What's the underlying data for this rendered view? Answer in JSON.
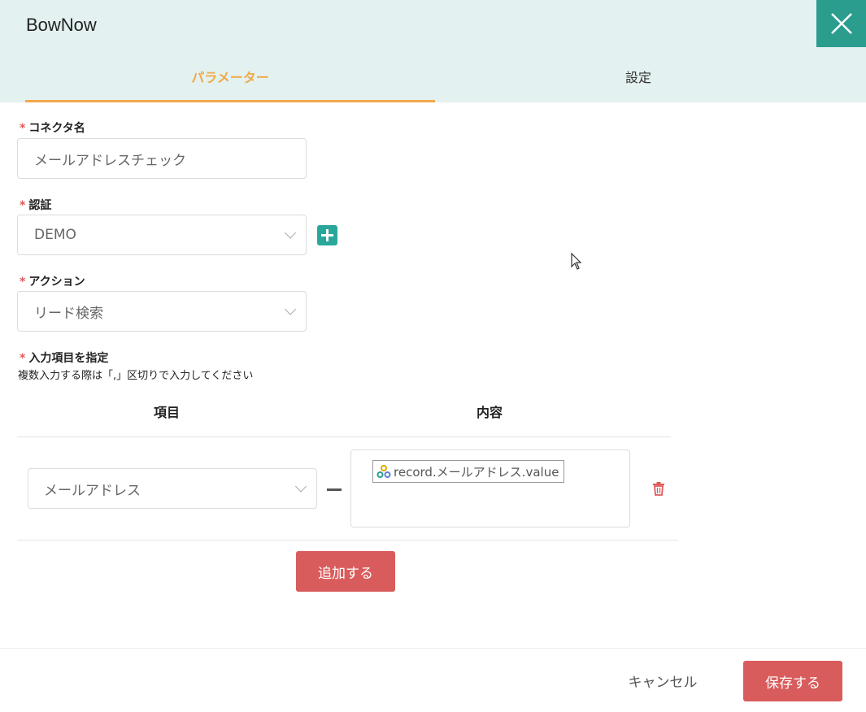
{
  "window": {
    "title": "BowNow"
  },
  "tabs": {
    "parameters": "パラメーター",
    "settings": "設定"
  },
  "form": {
    "required_mark": "*",
    "connector_name": {
      "label": "コネクタ名",
      "value": "メールアドレスチェック"
    },
    "auth": {
      "label": "認証",
      "value": "DEMO"
    },
    "action": {
      "label": "アクション",
      "value": "リード検索"
    },
    "inputs": {
      "label": "入力項目を指定",
      "hint": "複数入力する際は「,」区切りで入力してください",
      "col_item": "項目",
      "col_content": "内容",
      "rows": [
        {
          "item": "メールアドレス",
          "token": "record.メールアドレス.value"
        }
      ]
    }
  },
  "buttons": {
    "add": "追加する",
    "cancel": "キャンセル",
    "save": "保存する"
  },
  "colors": {
    "accent_orange": "#f0a949",
    "teal": "#2a9d8f",
    "danger_red": "#d95c5c",
    "header_bg": "#e3f1f0"
  }
}
